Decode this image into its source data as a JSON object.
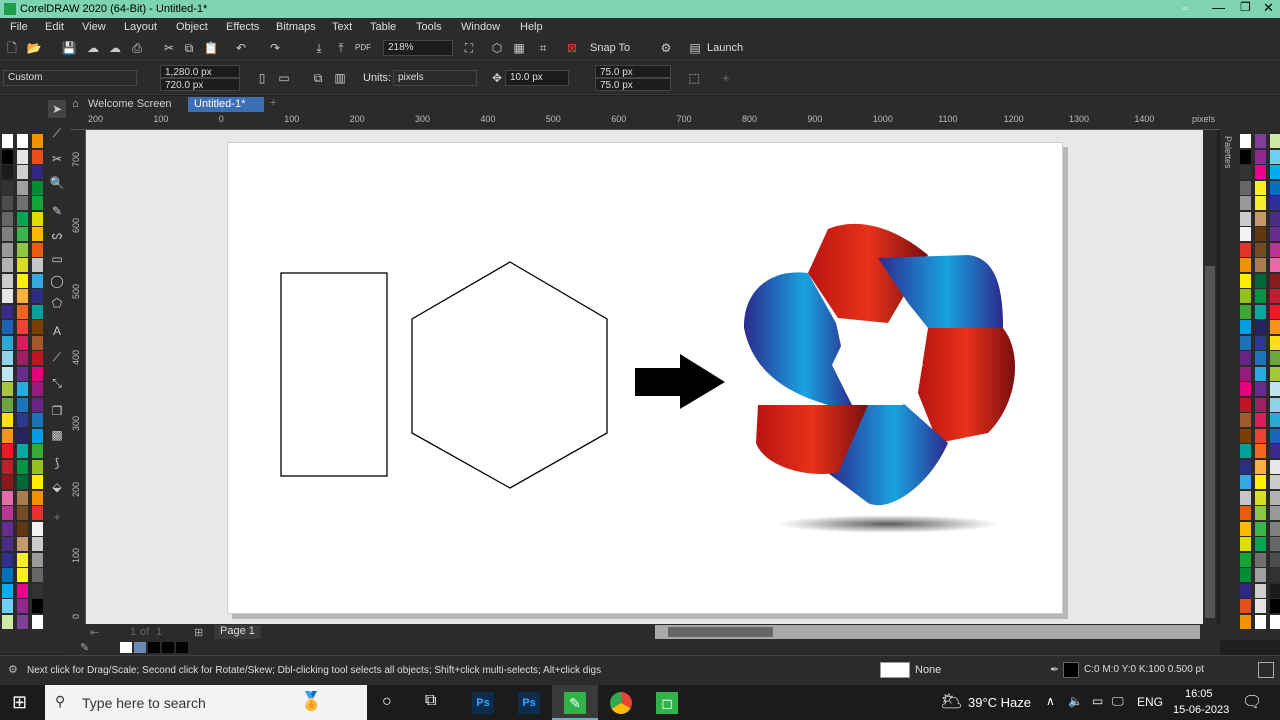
{
  "app": {
    "title": "CorelDRAW 2020 (64-Bit) - Untitled-1*"
  },
  "menu": [
    "File",
    "Edit",
    "View",
    "Layout",
    "Object",
    "Effects",
    "Bitmaps",
    "Text",
    "Table",
    "Tools",
    "Window",
    "Help"
  ],
  "toolbar": {
    "zoom": "218%",
    "snap_label": "Snap To",
    "launch_label": "Launch"
  },
  "propbar": {
    "preset": "Custom",
    "width": "1,280.0 px",
    "height": "720.0 px",
    "units_label": "Units:",
    "units_value": "pixels",
    "nudge": "10.0 px",
    "dup_x": "75.0 px",
    "dup_y": "75.0 px"
  },
  "tabs": {
    "welcome": "Welcome Screen",
    "doc": "Untitled-1*"
  },
  "rulers": {
    "h_ticks": [
      "200",
      "100",
      "0",
      "100",
      "200",
      "300",
      "400",
      "500",
      "600",
      "700",
      "800",
      "900",
      "1000",
      "1100",
      "1200",
      "1300",
      "1400"
    ],
    "h_unit": "pixels",
    "v_ticks": [
      "700",
      "600",
      "500",
      "400",
      "300",
      "200",
      "100",
      "0"
    ]
  },
  "page_nav": {
    "current": "1",
    "of": "of",
    "total": "1",
    "page_tab": "Page 1"
  },
  "right_panel": {
    "label": "Palettes"
  },
  "status": {
    "hint": "Next click for Drag/Scale; Second click for Rotate/Skew; Dbl-clicking tool selects all objects; Shift+click multi-selects; Alt+click digs",
    "fill": "None",
    "outline": "C:0 M:0 Y:0 K:100  0.500 pt"
  },
  "taskbar": {
    "search_placeholder": "Type here to search",
    "weather": "39°C  Haze",
    "lang": "ENG",
    "time": "16:05",
    "date": "15-06-2023"
  },
  "colors": {
    "title_bg": "#7ed3b2",
    "ui_bg": "#2b2b2b",
    "tab_active": "#3d6fb5",
    "workspace": "#e8e8e8"
  },
  "palette_left": [
    "#ffffff",
    "#000000",
    "#1a1a1a",
    "#333333",
    "#4d4d4d",
    "#666666",
    "#808080",
    "#999999",
    "#b3b3b3",
    "#cccccc",
    "#e6e6e6",
    "#3a2a8a",
    "#1e63b5",
    "#2aa8d8",
    "#8fd3e8",
    "#bfe6f0",
    "#a8c63a",
    "#6aa83c",
    "#ffde17",
    "#f7941d",
    "#ed1c24",
    "#be1e2d",
    "#8b1a1a",
    "#e96aa8",
    "#b83595",
    "#662d91",
    "#4b2e83",
    "#2e3192",
    "#0072bc",
    "#00aeef",
    "#6dcff6",
    "#cfe9a5"
  ],
  "palette_left2": [
    "#ffffff",
    "#e5e5e5",
    "#cfcfcf",
    "#a0a0a0",
    "#707070",
    "#00a651",
    "#39b54a",
    "#8dc63f",
    "#d7df23",
    "#fff200",
    "#fbb040",
    "#f26522",
    "#ef4136",
    "#da1c5c",
    "#9e1f63",
    "#662d91",
    "#29abe2",
    "#1b75bc",
    "#2b3990",
    "#262262",
    "#00a99d",
    "#009444",
    "#006838",
    "#a97c50",
    "#754c24",
    "#603913",
    "#c49a6c",
    "#f9ed32",
    "#fcee21",
    "#ec008c",
    "#92278f",
    "#7f3f98"
  ],
  "palette_right": [
    "#ffffff",
    "#000000",
    "#333333",
    "#666666",
    "#999999",
    "#cccccc",
    "#f2f2f2",
    "#e6332a",
    "#f29100",
    "#ffed00",
    "#95c11f",
    "#3aaa35",
    "#009fe3",
    "#1d71b8",
    "#662483",
    "#951b81",
    "#e6007e",
    "#be1622",
    "#a05a2c",
    "#7b3f00",
    "#00a19a",
    "#2d2e83",
    "#36a9e1",
    "#c6c6c6",
    "#ea5b0c",
    "#fbba00",
    "#dedc00",
    "#13a538",
    "#008d36",
    "#312783",
    "#e94e1b",
    "#f39200"
  ]
}
